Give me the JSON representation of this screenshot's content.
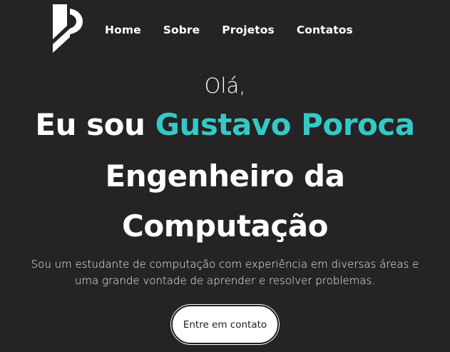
{
  "nav": {
    "items": [
      {
        "label": "Home"
      },
      {
        "label": "Sobre"
      },
      {
        "label": "Projetos"
      },
      {
        "label": "Contatos"
      }
    ]
  },
  "hero": {
    "greeting": "Olá,",
    "intro_prefix": "Eu sou ",
    "name": "Gustavo Poroca",
    "role_line1": "Engenheiro da",
    "role_line2": "Computação",
    "description_line1": "Sou um estudante de computação com experiência em diversas áreas e",
    "description_line2": "uma grande vontade de aprender e resolver problemas.",
    "cta_label": "Entre em contato"
  },
  "colors": {
    "background": "#252323",
    "accent": "#34c9c6",
    "text": "#ffffff"
  },
  "icons": {
    "logo": "p-logo-icon"
  }
}
